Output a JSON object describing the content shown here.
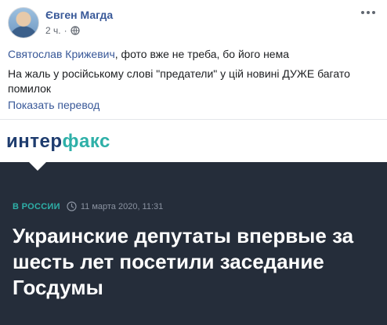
{
  "post": {
    "author": "Євген Магда",
    "time": "2 ч.",
    "privacy_icon": "globe-icon",
    "options_icon": "more-options-icon",
    "mention": "Святослав Крижевич",
    "comment_rest": ", фото вже не треба, бо його нема",
    "comment_second": "На жаль у російському слові \"предатели\" у цій новині ДУЖЕ багато помилок",
    "translate_link": "Показать перевод"
  },
  "shared_link": {
    "logo_main": "интер",
    "logo_accent": "факс",
    "category": "В РОССИИ",
    "clock_icon": "clock-icon",
    "date": "11 марта 2020, 11:31",
    "headline": "Украинские депутаты впервые за шесть лет посетили заседание Госдумы"
  },
  "colors": {
    "link": "#385898",
    "accent": "#2eb0a8",
    "article_bg": "#252d3a"
  }
}
